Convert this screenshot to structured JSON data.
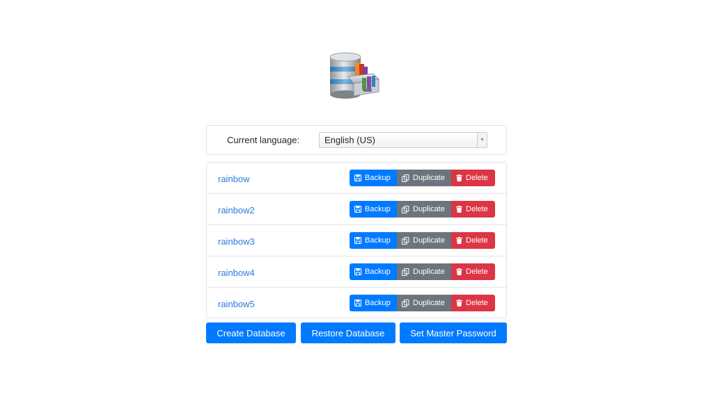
{
  "logo": {
    "icon": "database-drawer-icon"
  },
  "language": {
    "label": "Current language:",
    "selected": "English (US)"
  },
  "databases": [
    {
      "name": "rainbow"
    },
    {
      "name": "rainbow2"
    },
    {
      "name": "rainbow3"
    },
    {
      "name": "rainbow4"
    },
    {
      "name": "rainbow5"
    }
  ],
  "row_actions": {
    "backup": "Backup",
    "duplicate": "Duplicate",
    "delete": "Delete"
  },
  "actions": {
    "create": "Create Database",
    "restore": "Restore Database",
    "master_password": "Set Master Password"
  },
  "colors": {
    "primary": "#007bff",
    "secondary": "#6c757d",
    "danger": "#dc3545",
    "link": "#2a7ae2"
  }
}
